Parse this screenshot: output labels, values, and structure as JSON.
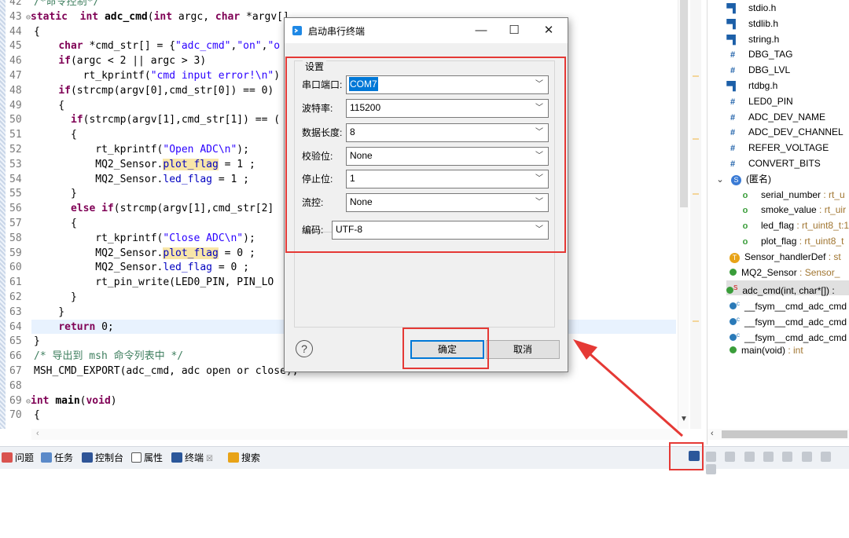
{
  "editor": {
    "lines": [
      {
        "n": "42",
        "t": [
          [
            "cm",
            "/*命令控制*/"
          ]
        ]
      },
      {
        "n": "43",
        "fold": true,
        "t": [
          [
            "kw",
            "static"
          ],
          [
            "",
            "  "
          ],
          [
            "kw",
            "int"
          ],
          [
            "",
            " "
          ],
          [
            "b",
            "adc_cmd"
          ],
          [
            "",
            "("
          ],
          [
            "kw",
            "int"
          ],
          [
            "",
            " argc, "
          ],
          [
            "kw",
            "char"
          ],
          [
            "",
            " *argv[]"
          ]
        ]
      },
      {
        "n": "44",
        "t": [
          [
            "",
            "{"
          ]
        ]
      },
      {
        "n": "45",
        "t": [
          [
            "",
            "    "
          ],
          [
            "kw",
            "char"
          ],
          [
            "",
            " *cmd_str[] = {"
          ],
          [
            "str",
            "\"adc_cmd\""
          ],
          [
            "",
            ","
          ],
          [
            "str",
            "\"on\""
          ],
          [
            "",
            ","
          ],
          [
            "str",
            "\"o"
          ]
        ]
      },
      {
        "n": "46",
        "t": [
          [
            "",
            "    "
          ],
          [
            "kw",
            "if"
          ],
          [
            "",
            "(argc < 2 || argc > 3)"
          ]
        ]
      },
      {
        "n": "47",
        "t": [
          [
            "",
            "        rt_kprintf("
          ],
          [
            "str",
            "\"cmd input error!\\n\""
          ],
          [
            "",
            ")"
          ]
        ]
      },
      {
        "n": "48",
        "t": [
          [
            "",
            "    "
          ],
          [
            "kw",
            "if"
          ],
          [
            "",
            "(strcmp(argv[0],cmd_str[0]) == 0)"
          ]
        ]
      },
      {
        "n": "49",
        "t": [
          [
            "",
            "    {"
          ]
        ]
      },
      {
        "n": "50",
        "t": [
          [
            "",
            "      "
          ],
          [
            "kw",
            "if"
          ],
          [
            "",
            "(strcmp(argv[1],cmd_str[1]) == ("
          ]
        ]
      },
      {
        "n": "51",
        "t": [
          [
            "",
            "      {"
          ]
        ]
      },
      {
        "n": "52",
        "t": [
          [
            "",
            "          rt_kprintf("
          ],
          [
            "str",
            "\"Open ADC\\n\""
          ],
          [
            "",
            ");"
          ]
        ]
      },
      {
        "n": "53",
        "t": [
          [
            "",
            "          MQ2_Sensor."
          ],
          [
            "fldh",
            "plot_flag"
          ],
          [
            "",
            " = 1 ;"
          ]
        ]
      },
      {
        "n": "54",
        "t": [
          [
            "",
            "          MQ2_Sensor."
          ],
          [
            "fld",
            "led_flag"
          ],
          [
            "",
            " = 1 ;"
          ]
        ]
      },
      {
        "n": "55",
        "t": [
          [
            "",
            "      }"
          ]
        ]
      },
      {
        "n": "56",
        "t": [
          [
            "",
            "      "
          ],
          [
            "kw",
            "else"
          ],
          [
            "",
            " "
          ],
          [
            "kw",
            "if"
          ],
          [
            "",
            "(strcmp(argv[1],cmd_str[2]"
          ]
        ]
      },
      {
        "n": "57",
        "t": [
          [
            "",
            "      {"
          ]
        ]
      },
      {
        "n": "58",
        "t": [
          [
            "",
            "          rt_kprintf("
          ],
          [
            "str",
            "\"Close ADC\\n\""
          ],
          [
            "",
            ");"
          ]
        ]
      },
      {
        "n": "59",
        "t": [
          [
            "",
            "          MQ2_Sensor."
          ],
          [
            "fldh",
            "plot_flag"
          ],
          [
            "",
            " = 0 ;"
          ]
        ]
      },
      {
        "n": "60",
        "t": [
          [
            "",
            "          MQ2_Sensor."
          ],
          [
            "fld",
            "led_flag"
          ],
          [
            "",
            " = 0 ;"
          ]
        ]
      },
      {
        "n": "61",
        "t": [
          [
            "",
            "          rt_pin_write(LED0_PIN, PIN_LO"
          ]
        ]
      },
      {
        "n": "62",
        "t": [
          [
            "",
            "      }"
          ]
        ]
      },
      {
        "n": "63",
        "t": [
          [
            "",
            "    }"
          ]
        ]
      },
      {
        "n": "64",
        "t": [
          [
            "",
            "    "
          ],
          [
            "kw",
            "return"
          ],
          [
            "",
            " 0;"
          ]
        ]
      },
      {
        "n": "65",
        "t": [
          [
            "",
            "}"
          ]
        ]
      },
      {
        "n": "66",
        "t": [
          [
            "cm",
            "/* 导出到 msh 命令列表中 */"
          ]
        ]
      },
      {
        "n": "67",
        "t": [
          [
            "",
            "MSH_CMD_EXPORT(adc_cmd, adc open or close);"
          ]
        ]
      },
      {
        "n": "68",
        "t": [
          [
            "",
            ""
          ]
        ]
      },
      {
        "n": "69",
        "fold": true,
        "t": [
          [
            "kw",
            "int"
          ],
          [
            "",
            " "
          ],
          [
            "b",
            "main"
          ],
          [
            "",
            "("
          ],
          [
            "kw",
            "void"
          ],
          [
            "",
            ")"
          ]
        ]
      },
      {
        "n": "70",
        "t": [
          [
            "",
            "{"
          ]
        ]
      }
    ]
  },
  "outline": {
    "items": [
      {
        "kind": "h",
        "label": "stdio.h"
      },
      {
        "kind": "h",
        "label": "stdlib.h"
      },
      {
        "kind": "h",
        "label": "string.h"
      },
      {
        "kind": "def",
        "label": "DBG_TAG"
      },
      {
        "kind": "def",
        "label": "DBG_LVL"
      },
      {
        "kind": "h",
        "label": "rtdbg.h"
      },
      {
        "kind": "def",
        "label": "LED0_PIN"
      },
      {
        "kind": "def",
        "label": "ADC_DEV_NAME"
      },
      {
        "kind": "def",
        "label": "ADC_DEV_CHANNEL"
      },
      {
        "kind": "def",
        "label": "REFER_VOLTAGE"
      },
      {
        "kind": "def",
        "label": "CONVERT_BITS"
      },
      {
        "kind": "struct",
        "label": "(匿名)"
      },
      {
        "kind": "field",
        "label": "serial_number",
        "type": " : rt_u"
      },
      {
        "kind": "field",
        "label": "smoke_value",
        "type": " : rt_uir"
      },
      {
        "kind": "field",
        "label": "led_flag",
        "type": " : rt_uint8_t:1"
      },
      {
        "kind": "field",
        "label": "plot_flag",
        "type": " : rt_uint8_t"
      },
      {
        "kind": "typedef",
        "label": "Sensor_handlerDef",
        "type": " : st"
      },
      {
        "kind": "var",
        "label": "MQ2_Sensor",
        "type": " : Sensor_"
      },
      {
        "kind": "func",
        "label": "adc_cmd(int, char*[]) :"
      },
      {
        "kind": "fsym",
        "label": "__fsym__cmd_adc_cmd"
      },
      {
        "kind": "fsym",
        "label": "__fsym__cmd_adc_cmd"
      },
      {
        "kind": "fsym",
        "label": "__fsym__cmd_adc_cmd"
      },
      {
        "kind": "func2",
        "label": "main(void)",
        "type": " : int"
      }
    ]
  },
  "tabs": [
    {
      "label": "问题"
    },
    {
      "label": "任务"
    },
    {
      "label": "控制台"
    },
    {
      "label": "属性"
    },
    {
      "label": "终端"
    },
    {
      "label": "搜索"
    }
  ],
  "dialog": {
    "title": "启动串行终端",
    "group_label": "设置",
    "fields": [
      {
        "label": "串口端口:",
        "value": "COM7"
      },
      {
        "label": "波特率:",
        "value": "115200"
      },
      {
        "label": "数据长度:",
        "value": "8"
      },
      {
        "label": "校验位:",
        "value": "None"
      },
      {
        "label": "停止位:",
        "value": "1"
      },
      {
        "label": "流控:",
        "value": "None"
      }
    ],
    "encoding": {
      "label": "编码:",
      "value": "UTF-8"
    },
    "help_glyph": "?",
    "ok_label": "确定",
    "cancel_label": "取消",
    "minimize_glyph": "—",
    "maximize_glyph": "☐",
    "close_glyph": "✕"
  },
  "colors": {
    "annotation_red": "#e53935",
    "selection": "#0078d7"
  }
}
